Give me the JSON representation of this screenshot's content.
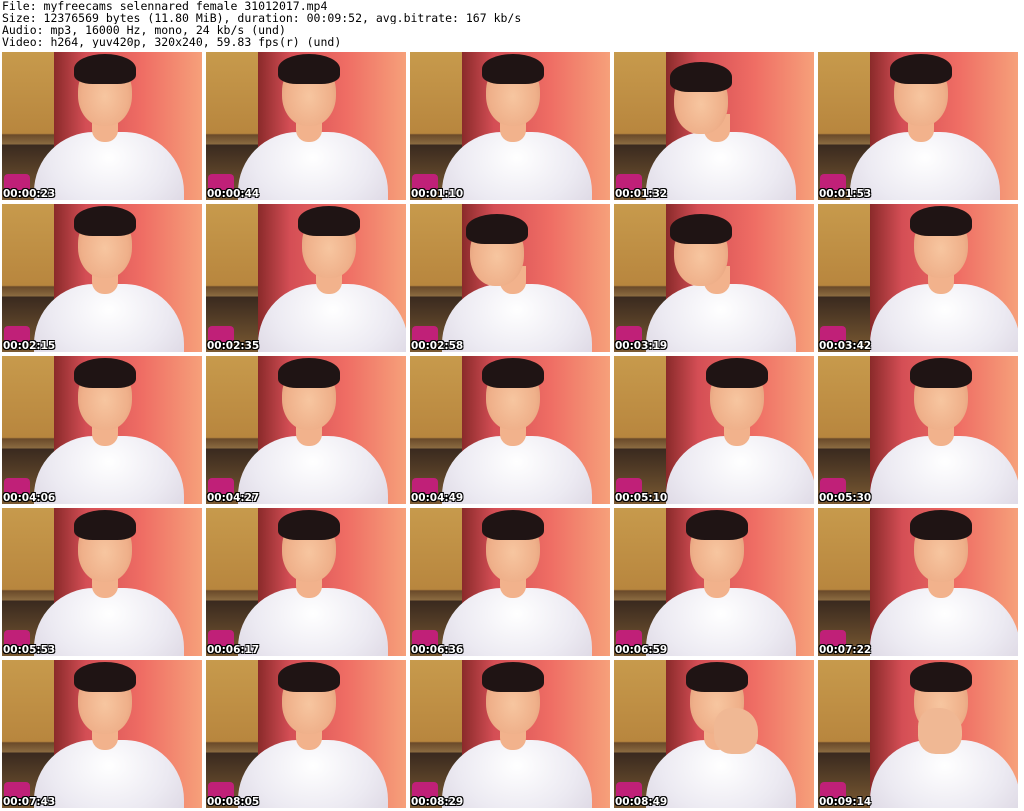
{
  "header": {
    "file_line": "File: myfreecams_selennared_female_31012017.mp4",
    "size_line": "Size: 12376569 bytes (11.80 MiB), duration: 00:09:52, avg.bitrate: 167 kb/s",
    "audio_line": "Audio: mp3, 16000 Hz, mono, 24 kb/s (und)",
    "video_line": "Video: h264, yuv420p, 320x240, 59.83 fps(r) (und)"
  },
  "thumbnails": [
    {
      "timestamp": "00:00:23"
    },
    {
      "timestamp": "00:00:44"
    },
    {
      "timestamp": "00:01:10"
    },
    {
      "timestamp": "00:01:32"
    },
    {
      "timestamp": "00:01:53"
    },
    {
      "timestamp": "00:02:15"
    },
    {
      "timestamp": "00:02:35"
    },
    {
      "timestamp": "00:02:58"
    },
    {
      "timestamp": "00:03:19"
    },
    {
      "timestamp": "00:03:42"
    },
    {
      "timestamp": "00:04:06"
    },
    {
      "timestamp": "00:04:27"
    },
    {
      "timestamp": "00:04:49"
    },
    {
      "timestamp": "00:05:10"
    },
    {
      "timestamp": "00:05:30"
    },
    {
      "timestamp": "00:05:53"
    },
    {
      "timestamp": "00:06:17"
    },
    {
      "timestamp": "00:06:36"
    },
    {
      "timestamp": "00:06:59"
    },
    {
      "timestamp": "00:07:22"
    },
    {
      "timestamp": "00:07:43"
    },
    {
      "timestamp": "00:08:05"
    },
    {
      "timestamp": "00:08:29"
    },
    {
      "timestamp": "00:08:49"
    },
    {
      "timestamp": "00:09:14"
    }
  ]
}
